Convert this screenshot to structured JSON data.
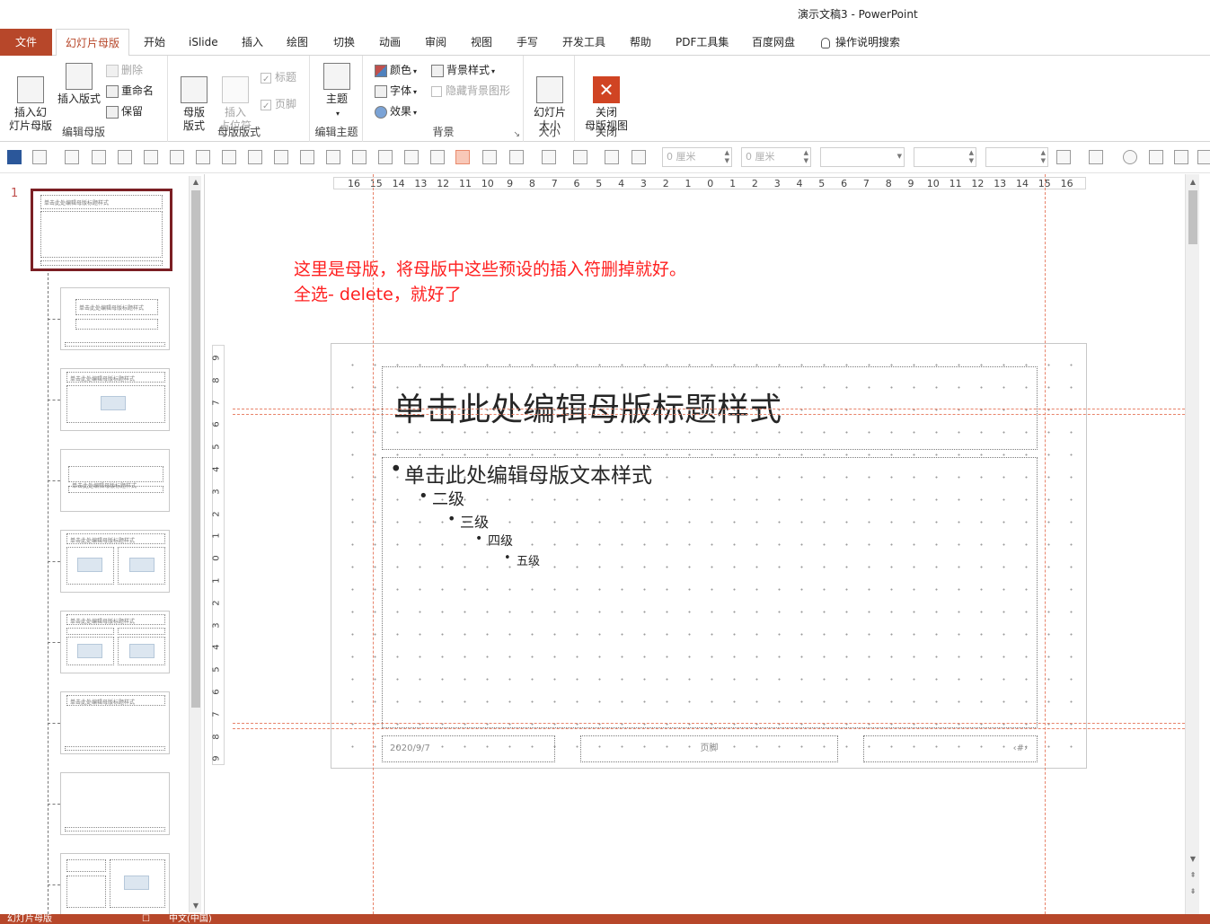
{
  "window": {
    "title": "演示文稿3  -  PowerPoint"
  },
  "tabs": [
    {
      "label": "文件"
    },
    {
      "label": "幻灯片母版"
    },
    {
      "label": "开始"
    },
    {
      "label": "iSlide"
    },
    {
      "label": "插入"
    },
    {
      "label": "绘图"
    },
    {
      "label": "切换"
    },
    {
      "label": "动画"
    },
    {
      "label": "审阅"
    },
    {
      "label": "视图"
    },
    {
      "label": "手写"
    },
    {
      "label": "开发工具"
    },
    {
      "label": "帮助"
    },
    {
      "label": "PDF工具集"
    },
    {
      "label": "百度网盘"
    },
    {
      "label": "操作说明搜索"
    }
  ],
  "ribbon": {
    "edit_master": {
      "label": "编辑母版",
      "insert_master": "插入幻\n灯片母版",
      "insert_layout": "插入版式",
      "delete": "删除",
      "rename": "重命名",
      "preserve": "保留"
    },
    "master_layout": {
      "label": "母版版式",
      "master_layout_btn": "母版\n版式",
      "insert_placeholder": "插入\n占位符",
      "title_check": "标题",
      "footer_check": "页脚"
    },
    "edit_theme": {
      "label": "编辑主题",
      "themes": "主题"
    },
    "background": {
      "label": "背景",
      "colors": "颜色",
      "fonts": "字体",
      "effects": "效果",
      "bg_styles": "背景样式",
      "hide_bg": "隐藏背景图形"
    },
    "size": {
      "label": "大小",
      "slide_size": "幻灯片\n大小"
    },
    "close": {
      "label": "关闭",
      "close_master": "关闭\n母版视图"
    }
  },
  "qat": {
    "width_value": "0 厘米",
    "height_value": "0 厘米"
  },
  "thumbnails": {
    "master_number": "1",
    "master_title": "单击此处编辑母版标题样式",
    "layout_title": "单击此处编辑母版标题样式"
  },
  "ruler": {
    "h_ticks": [
      "16",
      "15",
      "14",
      "13",
      "12",
      "11",
      "10",
      "9",
      "8",
      "7",
      "6",
      "5",
      "4",
      "3",
      "2",
      "1",
      "0",
      "1",
      "2",
      "3",
      "4",
      "5",
      "6",
      "7",
      "8",
      "9",
      "10",
      "11",
      "12",
      "13",
      "14",
      "15",
      "16"
    ],
    "v_ticks": [
      "9",
      "8",
      "7",
      "6",
      "5",
      "4",
      "3",
      "2",
      "1",
      "0",
      "1",
      "2",
      "3",
      "4",
      "5",
      "6",
      "7",
      "8",
      "9"
    ]
  },
  "annotation": {
    "line1": "这里是母版，将母版中这些预设的插入符删掉就好。",
    "line2": "全选- delete，就好了"
  },
  "slide": {
    "title": "单击此处编辑母版标题样式",
    "levels": [
      "单击此处编辑母版文本样式",
      "二级",
      "三级",
      "四级",
      "五级"
    ],
    "date": "2020/9/7",
    "footer": "页脚",
    "number": "‹#›"
  },
  "statusbar": {
    "view": "幻灯片母版",
    "language": "中文(中国)"
  },
  "colors": {
    "accent": "#b7472a",
    "annotation": "#ff2020",
    "guide": "#e8836a",
    "master_frame": "#7b1f24"
  }
}
